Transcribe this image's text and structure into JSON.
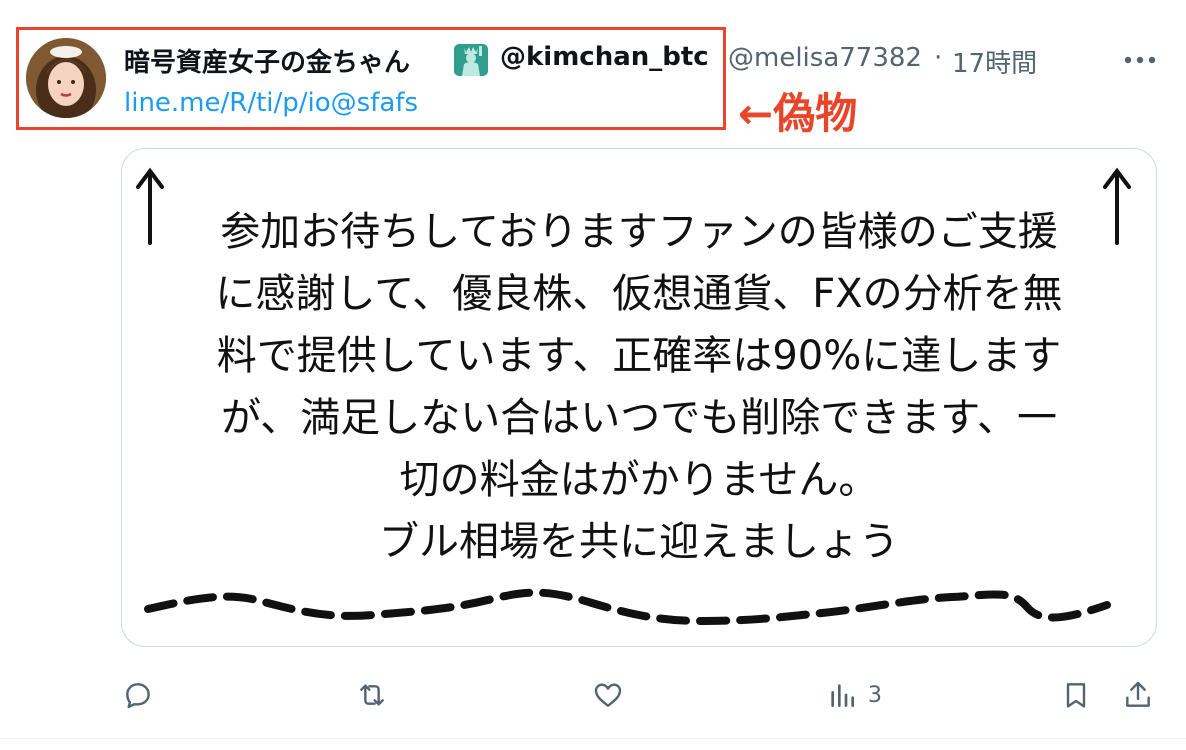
{
  "tweet": {
    "display_name": "暗号資産女子の金ちゃん",
    "fake_handle": "@kimchan_btc",
    "real_handle": "@melisa77382",
    "separator": "·",
    "timestamp": "17時間",
    "bio_link": "line.me/R/ti/p/io@sfafs",
    "annotation": "←偽物",
    "media_text": {
      "lines": [
        "参加お待ちしておりますファンの皆様のご支援",
        "に感謝して、優良株、仮想通貨、FXの分析を無",
        "料で提供しています、正確率は90%に達します",
        "が、満足しない合はいつでも削除できます、一",
        "切の料金はがかりません。",
        "ブル相場を共に迎えましょう"
      ]
    },
    "actions": {
      "views": "3"
    }
  },
  "colors": {
    "annotation_red": "#e8462b",
    "link_blue": "#1d9bf0",
    "muted_gray": "#536471"
  },
  "icons": [
    "avatar",
    "statue-of-liberty-icon",
    "more-icon",
    "reply-icon",
    "retweet-icon",
    "like-icon",
    "views-icon",
    "bookmark-icon",
    "share-icon"
  ]
}
